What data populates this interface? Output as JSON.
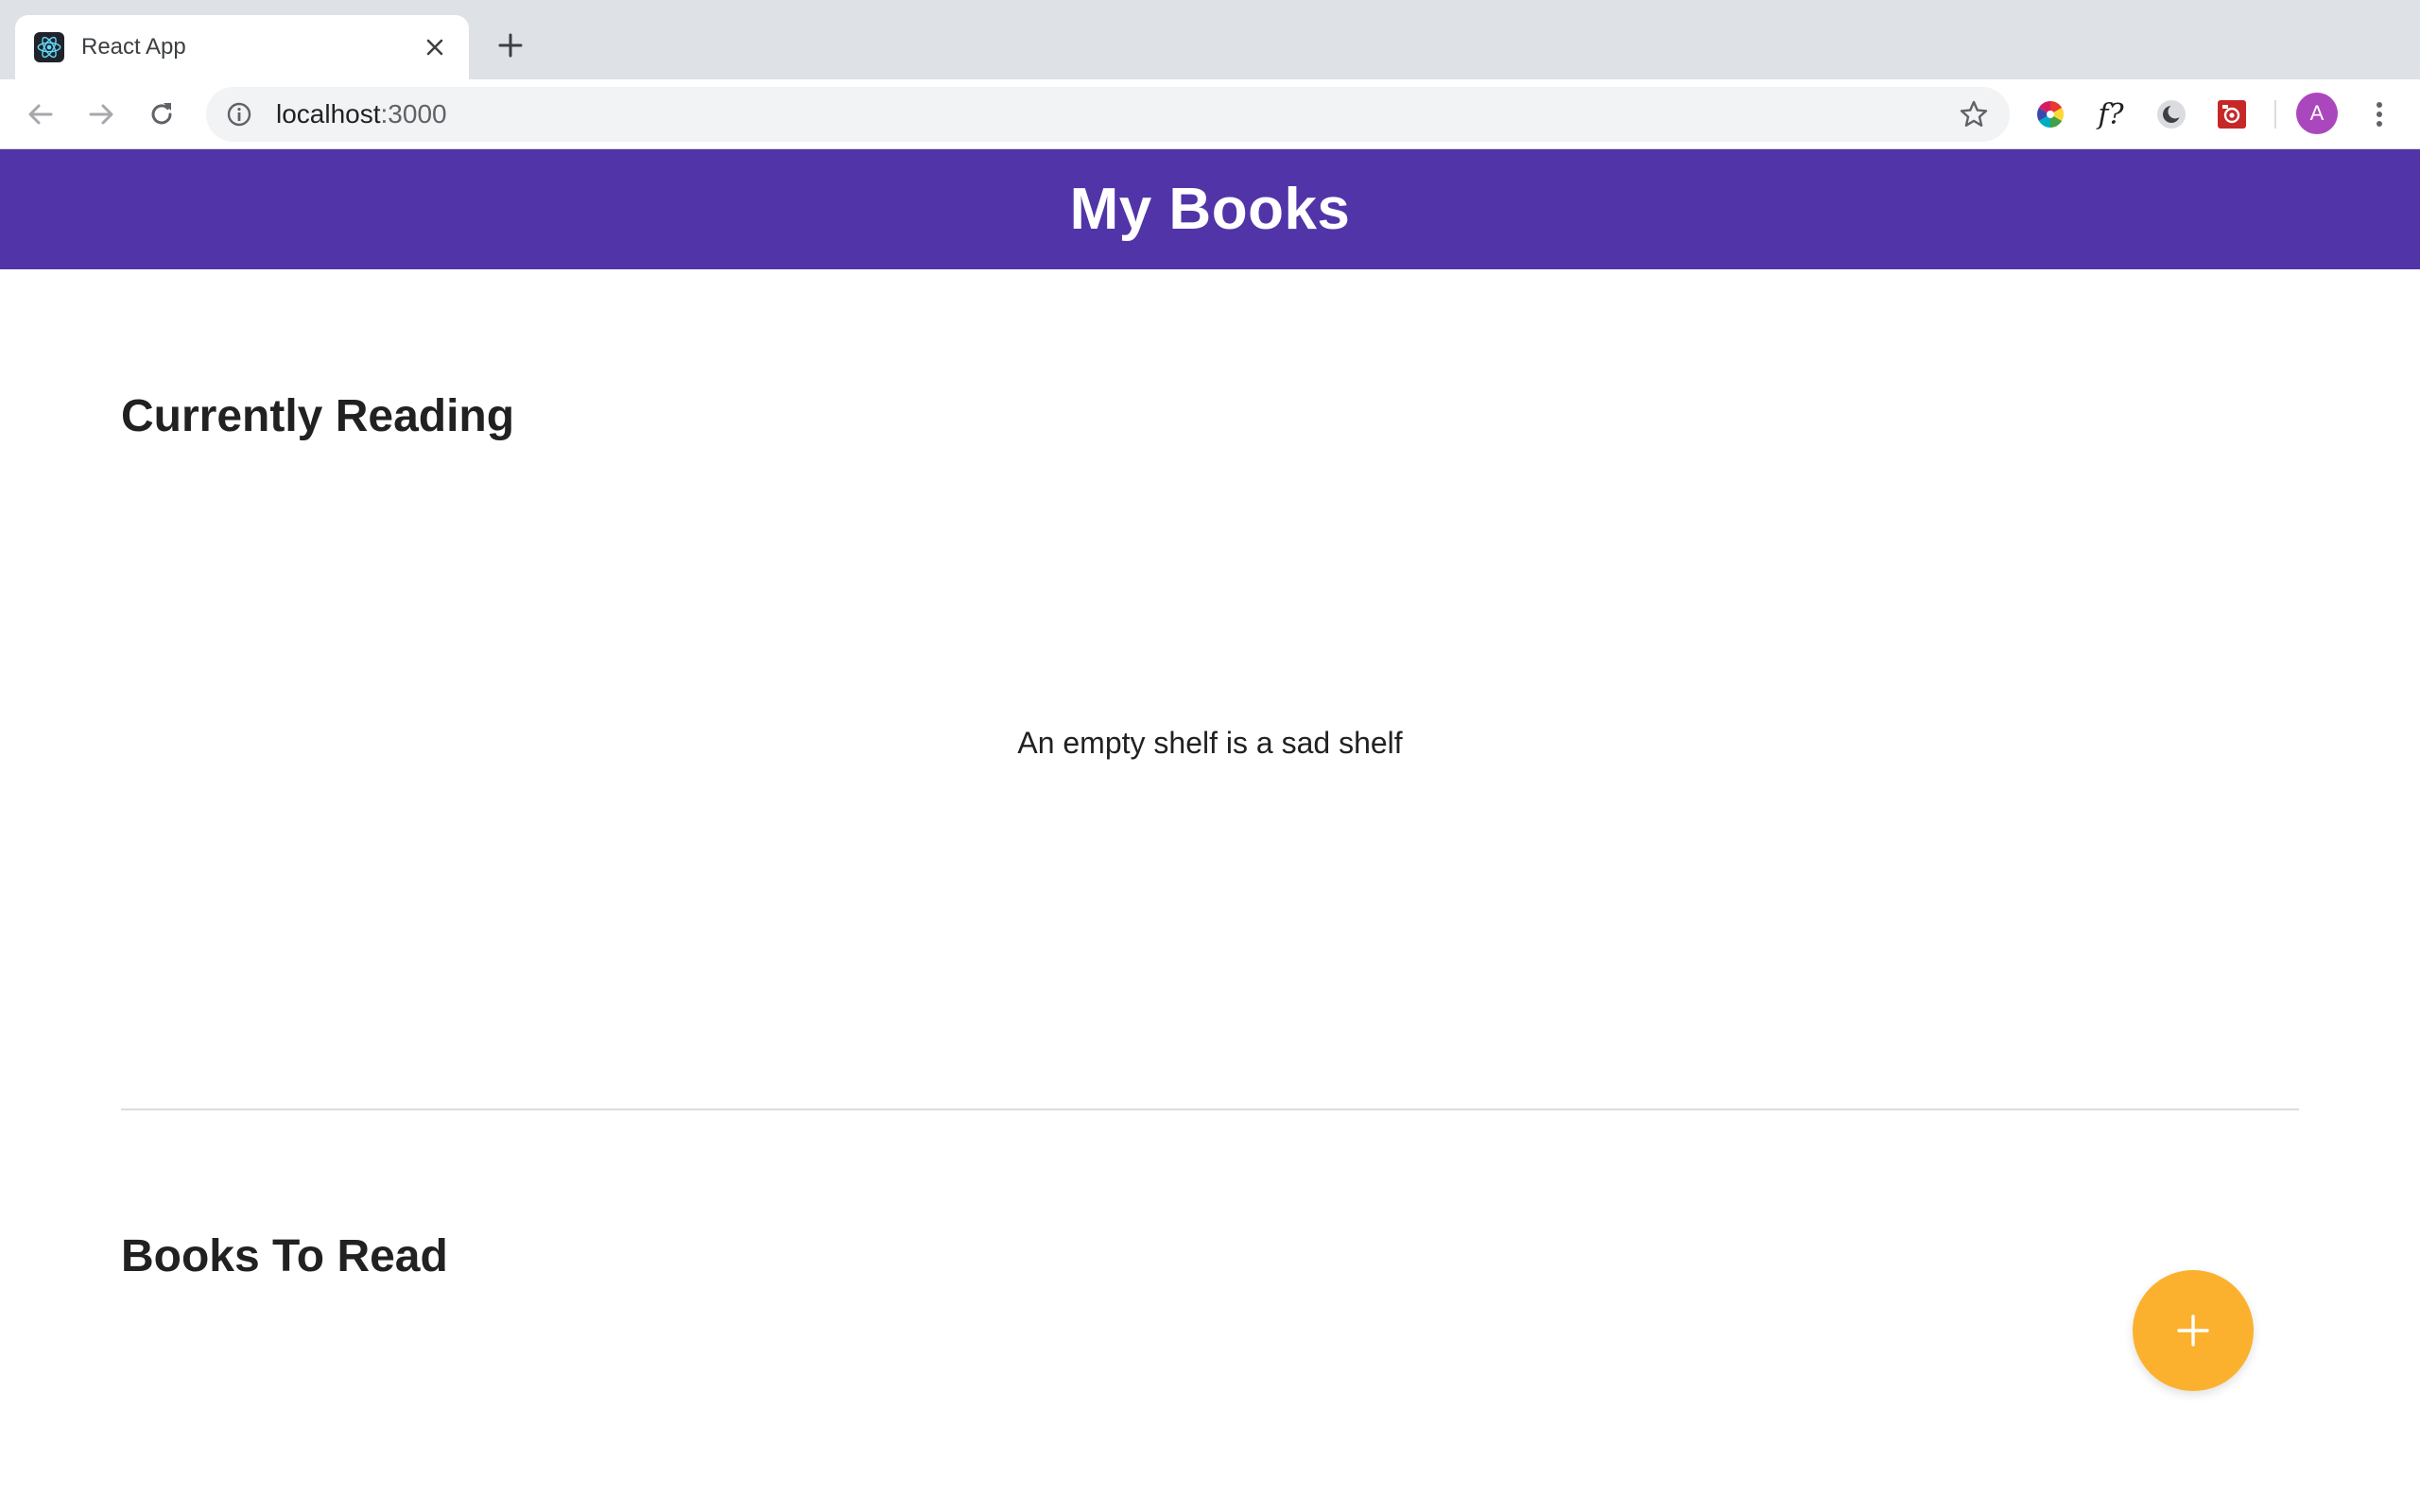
{
  "browser": {
    "tab": {
      "title": "React App",
      "favicon": "react-logo-icon",
      "close_icon": "close-icon"
    },
    "new_tab_icon": "plus-icon",
    "nav": {
      "back_icon": "arrow-left-icon",
      "forward_icon": "arrow-right-icon",
      "reload_icon": "reload-icon"
    },
    "omnibox": {
      "info_icon": "info-icon",
      "host": "localhost",
      "port": ":3000",
      "bookmark_icon": "star-icon"
    },
    "extensions": [
      {
        "name": "color-wheel-icon"
      },
      {
        "name": "font-finder-icon",
        "label": "f?"
      },
      {
        "name": "dark-mode-icon"
      },
      {
        "name": "screenshot-extension-icon"
      }
    ],
    "profile": {
      "initial": "A",
      "color": "#ab47bc"
    },
    "menu_icon": "more-vertical-icon"
  },
  "app": {
    "header": {
      "title": "My Books",
      "color": "#5134a8"
    },
    "shelves": [
      {
        "title": "Currently Reading",
        "empty_message": "An empty shelf is a sad shelf"
      },
      {
        "title": "Books To Read"
      }
    ],
    "fab": {
      "icon": "plus-icon",
      "color": "#fbb12e"
    }
  }
}
